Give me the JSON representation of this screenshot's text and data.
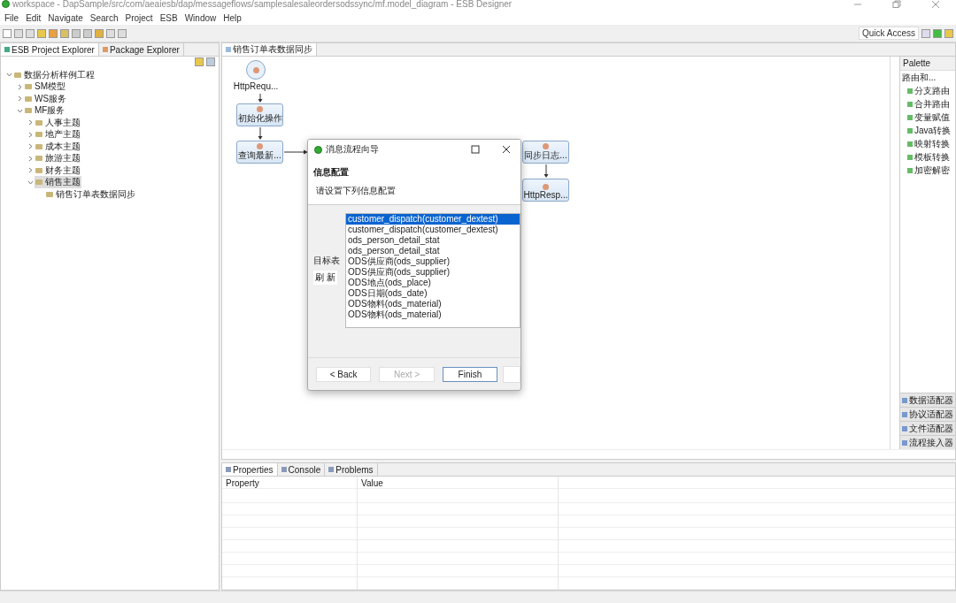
{
  "window": {
    "title": "workspace - DapSample/src/com/aeaiesb/dap/messageflows/samplesalesaleordersodssync/mf.model_diagram - ESB Designer"
  },
  "menu": [
    "File",
    "Edit",
    "Navigate",
    "Search",
    "Project",
    "ESB",
    "Window",
    "Help"
  ],
  "quick_access": "Quick Access",
  "explorer": {
    "tabs": [
      {
        "label": "ESB Project Explorer",
        "selected": true
      },
      {
        "label": "Package Explorer",
        "selected": false
      }
    ],
    "tree": [
      {
        "label": "数据分析样例工程",
        "expanded": true,
        "selected": false,
        "children": [
          {
            "label": "SM模型",
            "expanded": false,
            "selected": false
          },
          {
            "label": "WS服务",
            "expanded": false,
            "selected": false
          },
          {
            "label": "MF服务",
            "expanded": true,
            "selected": false,
            "children": [
              {
                "label": "人事主题",
                "expanded": false,
                "selected": false
              },
              {
                "label": "地产主题",
                "expanded": false,
                "selected": false
              },
              {
                "label": "成本主题",
                "expanded": false,
                "selected": false
              },
              {
                "label": "旅游主题",
                "expanded": false,
                "selected": false
              },
              {
                "label": "财务主题",
                "expanded": false,
                "selected": false
              },
              {
                "label": "销售主题",
                "expanded": true,
                "selected": true,
                "children": [
                  {
                    "label": "销售订单表数据同步",
                    "selected": false
                  }
                ]
              }
            ]
          }
        ]
      }
    ]
  },
  "editor": {
    "tab": "销售订单表数据同步",
    "nodes": [
      {
        "label": "HttpRequ...",
        "kind": "start"
      },
      {
        "label": "初始化操作",
        "kind": "task"
      },
      {
        "label": "查询最新...",
        "kind": "task"
      },
      {
        "label": "同步日志...",
        "kind": "task"
      },
      {
        "label": "HttpResp...",
        "kind": "task"
      }
    ]
  },
  "palette": {
    "title": "Palette",
    "drawer": "路由和...",
    "items": [
      "分支路由",
      "合并路由",
      "变量赋值",
      "Java转换",
      "映射转换",
      "模板转换",
      "加密解密"
    ],
    "drawers": [
      "数据适配器",
      "协议适配器",
      "文件适配器",
      "流程接入器"
    ]
  },
  "properties": {
    "tabs": [
      {
        "label": "Properties",
        "selected": true
      },
      {
        "label": "Console",
        "selected": false
      },
      {
        "label": "Problems",
        "selected": false
      }
    ],
    "columns": [
      "Property",
      "Value"
    ]
  },
  "dialog": {
    "title": "消息流程向导",
    "heading": "信息配置",
    "subtitle": "请设置下列信息配置",
    "target_label": "目标表",
    "refresh": "刷 新",
    "options": [
      {
        "label": "customer_dispatch(customer_dextest)",
        "selected": true
      },
      {
        "label": "customer_dispatch(customer_dextest)",
        "selected": false
      },
      {
        "label": "ods_person_detail_stat",
        "selected": false
      },
      {
        "label": "ods_person_detail_stat",
        "selected": false
      },
      {
        "label": "ODS供应商(ods_supplier)",
        "selected": false
      },
      {
        "label": "ODS供应商(ods_supplier)",
        "selected": false
      },
      {
        "label": "ODS地点(ods_place)",
        "selected": false
      },
      {
        "label": "ODS日期(ods_date)",
        "selected": false
      },
      {
        "label": "ODS物料(ods_material)",
        "selected": false
      },
      {
        "label": "ODS物料(ods_material)",
        "selected": false
      }
    ],
    "buttons": [
      {
        "label": "< Back",
        "disabled": false
      },
      {
        "label": "Next >",
        "disabled": true
      },
      {
        "label": "Finish",
        "disabled": false
      }
    ]
  }
}
